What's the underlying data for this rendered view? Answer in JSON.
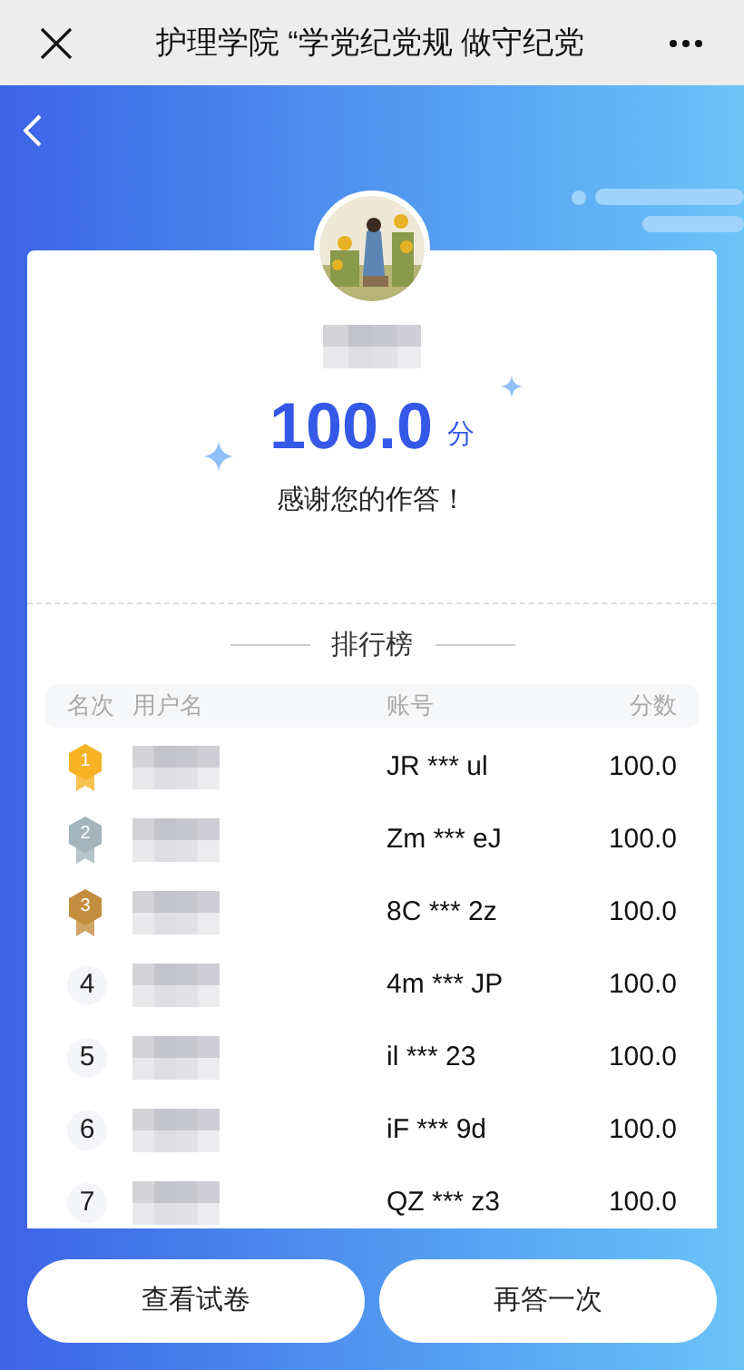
{
  "window": {
    "title": "护理学院 “学党纪党规 做守纪党"
  },
  "result": {
    "score": "100.0",
    "unit": "分",
    "message": "感谢您的作答！"
  },
  "ranking": {
    "title": "排行榜",
    "columns": [
      "名次",
      "用户名",
      "账号",
      "分数"
    ],
    "rows": [
      {
        "rank": "1",
        "kind": "medal",
        "color": "#f5b324",
        "account": "JR *** ul",
        "score": "100.0"
      },
      {
        "rank": "2",
        "kind": "medal",
        "color": "#a3b4bd",
        "account": "Zm *** eJ",
        "score": "100.0"
      },
      {
        "rank": "3",
        "kind": "medal",
        "color": "#c38d3f",
        "account": "8C *** 2z",
        "score": "100.0"
      },
      {
        "rank": "4",
        "kind": "plain",
        "account": "4m *** JP",
        "score": "100.0"
      },
      {
        "rank": "5",
        "kind": "plain",
        "account": "il *** 23",
        "score": "100.0"
      },
      {
        "rank": "6",
        "kind": "plain",
        "account": "iF *** 9d",
        "score": "100.0"
      },
      {
        "rank": "7",
        "kind": "plain",
        "account": "QZ *** z3",
        "score": "100.0"
      }
    ]
  },
  "buttons": [
    {
      "label": "查看试卷"
    },
    {
      "label": "再答一次"
    }
  ]
}
